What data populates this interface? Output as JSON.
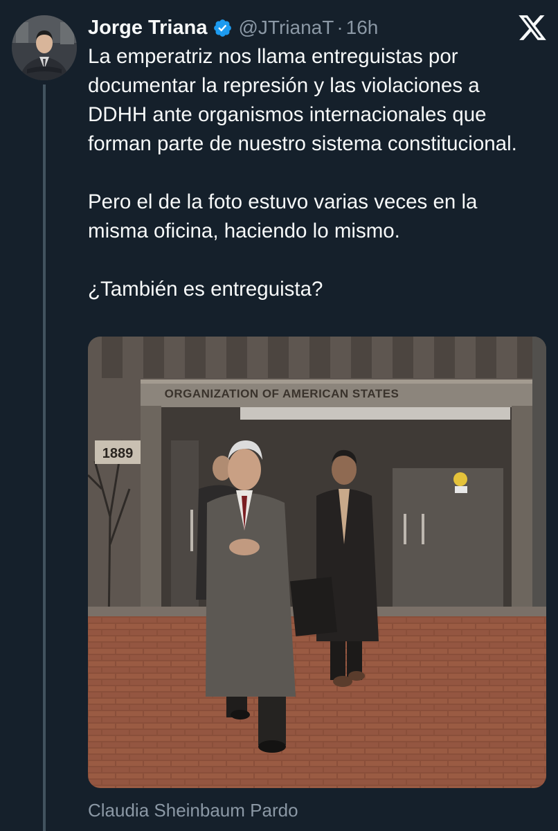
{
  "tweet": {
    "author_name": "Jorge Triana",
    "handle": "@JTrianaT",
    "separator": "·",
    "time": "16h",
    "paragraphs": [
      "La emperatriz nos llama entreguistas por documentar la represión y las violaciones a DDHH ante organismos internacionales que forman parte de nuestro sistema constitucional.",
      "Pero el de la foto estuvo varias veces en la misma oficina, haciendo lo mismo.",
      "¿También es entreguista?"
    ],
    "media": {
      "sign_text": "ORGANIZATION OF AMERICAN STATES",
      "address_number": "1889"
    },
    "caption": "Claudia Sheinbaum Pardo"
  },
  "icons": {
    "verified": "verified-badge-icon",
    "close": "x-logo-icon"
  },
  "colors": {
    "background": "#15202b",
    "text_primary": "#f7f9f9",
    "text_secondary": "#8b98a5",
    "verified": "#1d9bf0",
    "thread_line": "#42535f"
  }
}
